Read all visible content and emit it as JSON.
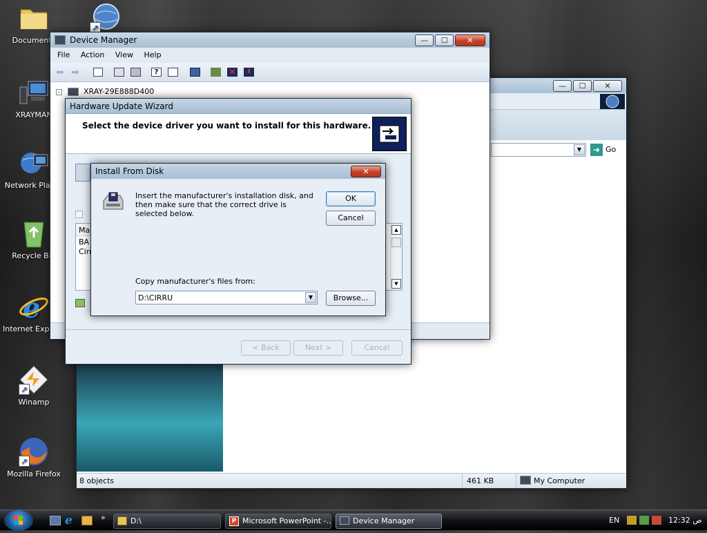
{
  "desktop": {
    "icons": [
      {
        "label": "Documents",
        "icon": "folder-icon"
      },
      {
        "label": "XRAYMAN",
        "icon": "computer-icon"
      },
      {
        "label": "Network Places",
        "icon": "network-icon"
      },
      {
        "label": "Recycle Bin",
        "icon": "recycle-bin-icon"
      },
      {
        "label": "Internet Explorer",
        "icon": "ie-icon"
      },
      {
        "label": "Winamp",
        "icon": "winamp-icon"
      },
      {
        "label": "Mozilla Firefox",
        "icon": "firefox-icon"
      }
    ]
  },
  "explorer": {
    "go_label": "Go",
    "status_objects": "8 objects",
    "status_size": "461 KB",
    "status_location": "My Computer"
  },
  "device_manager": {
    "title": "Device Manager",
    "menu": {
      "file": "File",
      "action": "Action",
      "view": "View",
      "help": "Help"
    },
    "tree_root": "XRAY-29E888D400"
  },
  "wizard": {
    "title": "Hardware Update Wizard",
    "heading": "Select the device driver you want to install for this hardware.",
    "list_header": "Ma",
    "list_items": [
      "BA",
      "Cirr"
    ],
    "back_label": "< Back",
    "next_label": "Next >",
    "cancel_label": "Cancel"
  },
  "install_dialog": {
    "title": "Install From Disk",
    "message": "Insert the manufacturer's installation disk, and then make sure that the correct drive is selected below.",
    "ok_label": "OK",
    "cancel_label": "Cancel",
    "copy_label": "Copy manufacturer's files from:",
    "path_value": "D:\\CIRRU",
    "browse_label": "Browse..."
  },
  "taskbar": {
    "tasks": [
      {
        "label": "D:\\",
        "icon": "folder-icon"
      },
      {
        "label": "Microsoft PowerPoint -...",
        "icon": "powerpoint-icon"
      },
      {
        "label": "Device Manager",
        "icon": "device-manager-icon"
      }
    ],
    "language": "EN",
    "clock": "12:32 ص"
  }
}
